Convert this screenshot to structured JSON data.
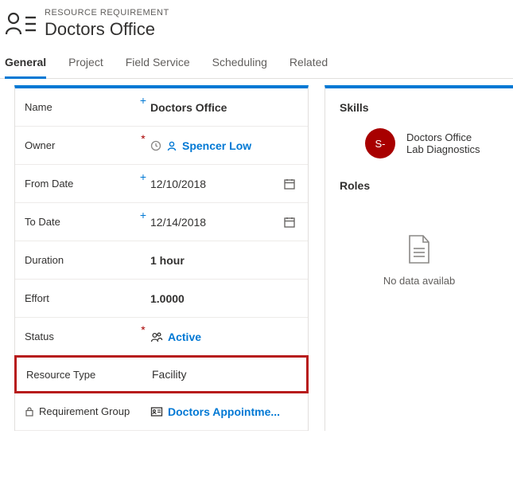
{
  "header": {
    "entity_label": "RESOURCE REQUIREMENT",
    "title": "Doctors Office"
  },
  "tabs": [
    {
      "label": "General",
      "active": true
    },
    {
      "label": "Project"
    },
    {
      "label": "Field Service"
    },
    {
      "label": "Scheduling"
    },
    {
      "label": "Related"
    }
  ],
  "form": {
    "name": {
      "label": "Name",
      "marker": "+",
      "value": "Doctors Office"
    },
    "owner": {
      "label": "Owner",
      "marker": "*",
      "value": "Spencer Low"
    },
    "from_date": {
      "label": "From Date",
      "marker": "+",
      "value": "12/10/2018"
    },
    "to_date": {
      "label": "To Date",
      "marker": "+",
      "value": "12/14/2018"
    },
    "duration": {
      "label": "Duration",
      "value": "1 hour"
    },
    "effort": {
      "label": "Effort",
      "value": "1.0000"
    },
    "status": {
      "label": "Status",
      "marker": "*",
      "value": "Active"
    },
    "resource_type": {
      "label": "Resource Type",
      "value": "Facility"
    },
    "req_group": {
      "label": "Requirement Group",
      "value": "Doctors Appointme..."
    }
  },
  "right": {
    "skills_h": "Skills",
    "skill_avatar": "S-",
    "skill_line1": "Doctors Office",
    "skill_line2": "Lab Diagnostics",
    "roles_h": "Roles",
    "no_data": "No data availab"
  }
}
